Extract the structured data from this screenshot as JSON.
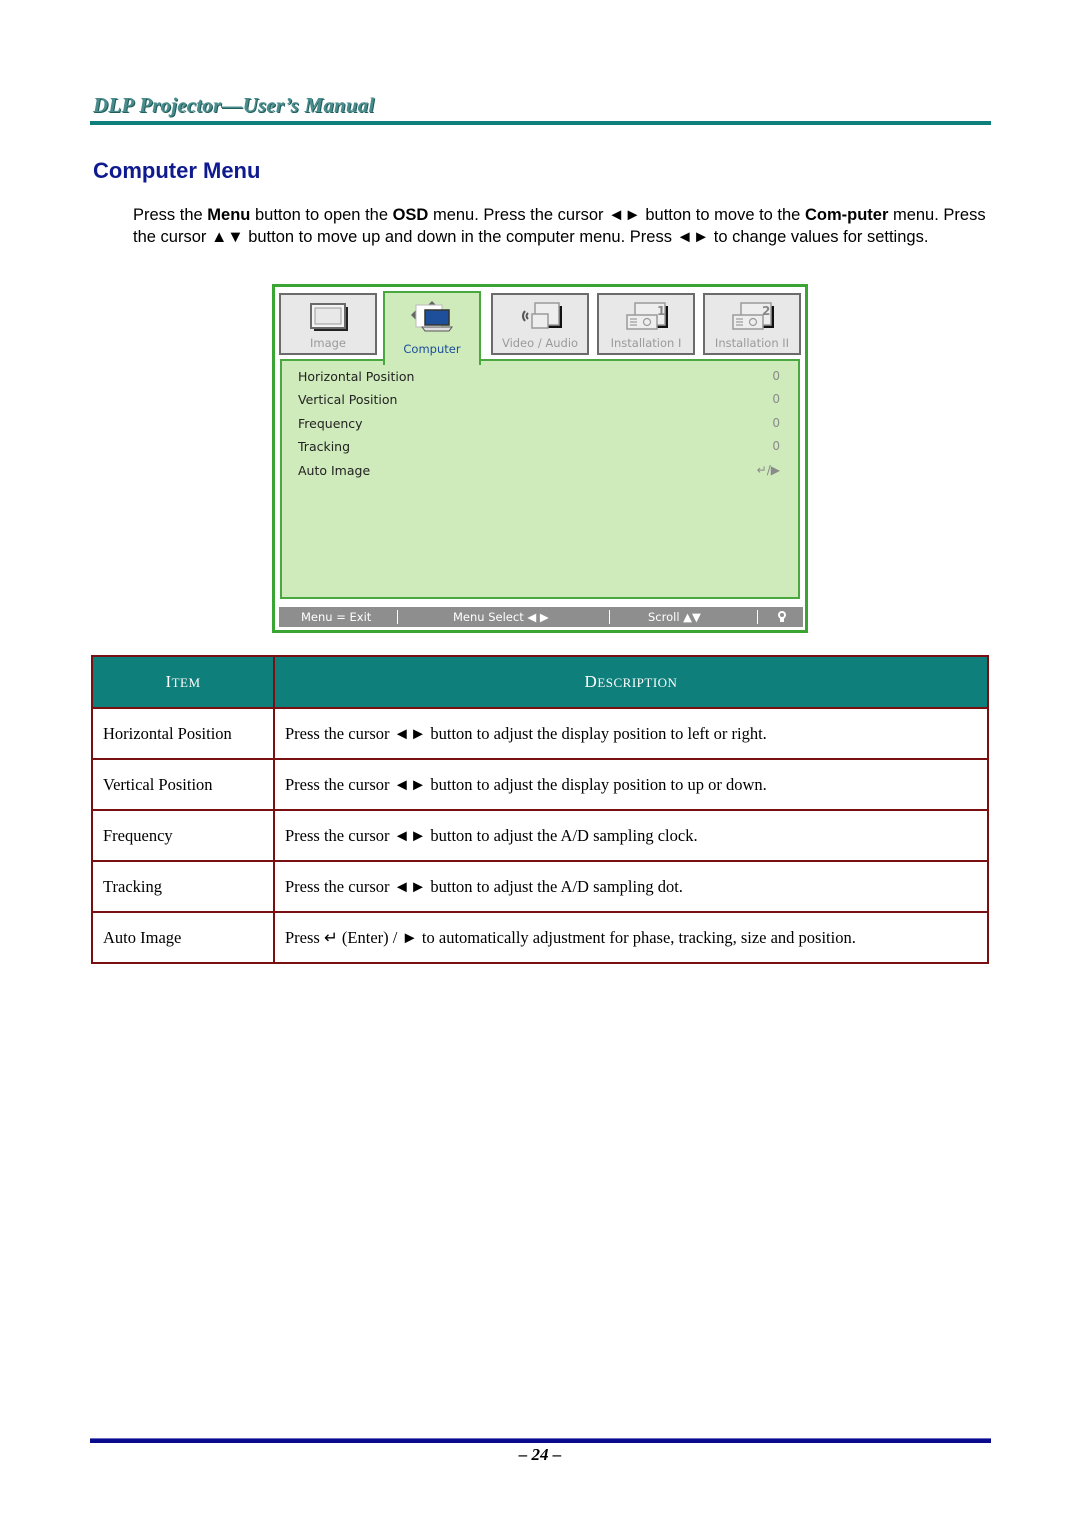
{
  "header": {
    "title": "DLP Projector—User’s Manual",
    "accent_color": "#0e7f7a"
  },
  "section": {
    "title": "Computer Menu",
    "title_color": "#0f1a8f"
  },
  "intro": {
    "t1": "Press the ",
    "b1": "Menu",
    "t2": " button to open the ",
    "b2": "OSD",
    "t3": " menu. Press the cursor ◄► button to move to the ",
    "b3": "Com-puter",
    "t4": " menu. Press the cursor ▲▼ button to move up and down in the computer menu. Press ◄► to change values for settings."
  },
  "osd": {
    "tabs": [
      {
        "label": "Image",
        "icon": "image-icon",
        "active": false
      },
      {
        "label": "Computer",
        "icon": "computer-icon",
        "active": true
      },
      {
        "label": "Video / Audio",
        "icon": "video-audio-icon",
        "active": false
      },
      {
        "label": "Installation I",
        "icon": "installation-1-icon",
        "active": false
      },
      {
        "label": "Installation II",
        "icon": "installation-2-icon",
        "active": false
      }
    ],
    "items": [
      {
        "label": "Horizontal Position",
        "value": "0"
      },
      {
        "label": "Vertical Position",
        "value": "0"
      },
      {
        "label": "Frequency",
        "value": "0"
      },
      {
        "label": "Tracking",
        "value": "0"
      },
      {
        "label": "Auto Image",
        "value": "↵/▶"
      }
    ],
    "footer": {
      "exit": "Menu = Exit",
      "select": "Menu Select ◀ ▶",
      "scroll": "Scroll ▲▼",
      "lamp_icon": "lightbulb-icon"
    },
    "colors": {
      "border": "#3aa532",
      "panel": "#cfebbb",
      "footer": "#8e8e8e",
      "active_label": "#1b4d9b"
    }
  },
  "table": {
    "headers": {
      "item_first": "I",
      "item_rest": "TEM",
      "desc_first": "D",
      "desc_rest": "ESCRIPTION"
    },
    "rows": [
      {
        "item": "Horizontal Position",
        "description": "Press the cursor ◄► button to adjust the display position to left or right."
      },
      {
        "item": "Vertical Position",
        "description": "Press the cursor ◄► button to adjust the display position to up or down."
      },
      {
        "item": "Frequency",
        "description": "Press the cursor ◄► button to adjust the A/D sampling clock."
      },
      {
        "item": "Tracking",
        "description": "Press the cursor ◄► button to adjust the A/D sampling dot."
      },
      {
        "item": "Auto Image",
        "description": "Press ↵ (Enter) / ► to automatically adjustment for phase, tracking, size and position."
      }
    ],
    "colors": {
      "header_bg": "#0e7f7a",
      "border": "#7a0f12"
    }
  },
  "footer": {
    "page_number": "– 24 –"
  }
}
